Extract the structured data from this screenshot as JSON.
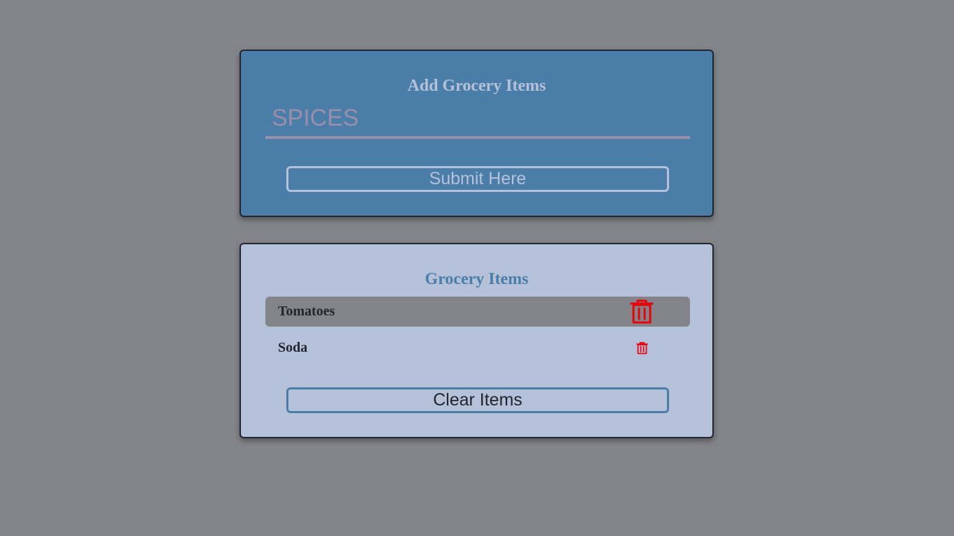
{
  "add_card": {
    "title": "Add Grocery Items",
    "input_value": "SPICES",
    "submit_label": "Submit Here"
  },
  "list_card": {
    "title": "Grocery Items",
    "items": [
      {
        "name": "Tomatoes",
        "delete_icon": "trash-icon",
        "highlighted": true
      },
      {
        "name": "Soda",
        "delete_icon": "trash-icon",
        "highlighted": false
      }
    ],
    "clear_label": "Clear Items"
  },
  "colors": {
    "background": "#838489",
    "add_card": "#4a7ea8",
    "list_card": "#b5c1d9",
    "delete_icon": "#e8000b",
    "text_dark": "#23252f"
  }
}
